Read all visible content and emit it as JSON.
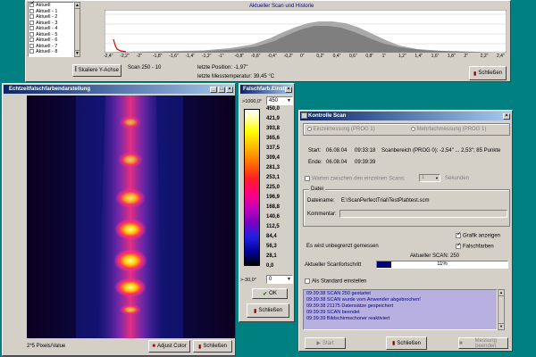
{
  "history_window": {
    "channels": [
      "Aktuell",
      "Aktuell - 1",
      "Aktuell - 2",
      "Aktuell - 3",
      "Aktuell - 4",
      "Aktuell - 5",
      "Aktuell - 6",
      "Aktuell - 7",
      "Aktuell - 8"
    ],
    "chart_title": "Aktueller Scan und Historie",
    "y_ticks": [
      "200 °C",
      "150 °C",
      "100 °C",
      "50 °C"
    ],
    "x_ticks": [
      "-2,4\"",
      "-2,2\"",
      "-2\"",
      "-1,8\"",
      "-1,6\"",
      "-1,4\"",
      "-1,2\"",
      "-1\"",
      "-0,8\"",
      "-0,6\"",
      "-0,4\"",
      "-0,2\"",
      "0\"",
      "0,2\"",
      "0,4\"",
      "0,6\"",
      "0,8\"",
      "1\"",
      "1,2\"",
      "1,4\"",
      "1,6\"",
      "1,8\"",
      "2\"",
      "2,2\"",
      "2,4\""
    ],
    "scale_button": "Skaliere Y-Achse",
    "scan_label": "Scan 250 - 10",
    "last_position": "letzte Position: -1,97\"",
    "last_temperature": "letzte Messtemperatur: 39,45 °C",
    "close_button": "Schließen"
  },
  "falsecolor_window": {
    "title": "Echtzeitfalschfarbendarstellung",
    "status": "2*5 Pixels/Value",
    "adjust_button": "Adjust Color",
    "close_button": "Schließen"
  },
  "scale_window": {
    "title": "Falschfarb.Einst.",
    "max_label": ">1000,0°",
    "max_value": "450",
    "labels": [
      "450,0",
      "421,9",
      "393,8",
      "365,6",
      "337,5",
      "309,4",
      "281,3",
      "253,1",
      "225,0",
      "196,9",
      "168,8",
      "140,6",
      "112,5",
      "84,4",
      "56,3",
      "28,1",
      "0,0"
    ],
    "min_label": ">-30,0°",
    "min_value": "0",
    "ok_button": "OK",
    "close_button": "Schließen"
  },
  "control_window": {
    "title": "Kontrolle Scan",
    "single_measure": "Einzelmessung (PROG 1)",
    "multi_measure": "Mehrfachmessung (PROG 1)",
    "start_label": "Start:",
    "start_date": "06.08.04",
    "start_time": "09:33:18",
    "end_label": "Ende:",
    "end_date": "06.08.04",
    "end_time": "09:39:39",
    "scan_range": "Scanbereich (PROG 0): -2,54\" ... 2,53\"; 85 Punkte",
    "wait_label": "Warten zwischen den einzelnen Scans:",
    "wait_value": "1",
    "wait_unit": "Sekunden",
    "file_group": "Datei",
    "filename_label": "Dateiname:",
    "filename_value": "E:\\ScanPerfectTrial\\TestPlat\\test.scm",
    "comment_label": "Kommentar:",
    "show_graph": "Grafik anzeigen",
    "false_colors": "Falschfarben",
    "status": "Es wird unbegrenzt gemessen",
    "current_scan": "Aktueller SCAN: 250",
    "progress_label": "Aktueller Scanfortschritt",
    "progress_text": "11%",
    "progress_value": 0.11,
    "default_checkbox": "Als Standard einstellen",
    "log": [
      "09:39:38 SCAN 250 gestartet",
      "09:39:38 SCAN wurde vom Anwender abgebrochen!",
      "09:39:38 21175 Datensätze gespeichert",
      "09:39:39 SCAN beendet",
      "09:39:39 Bildschirmschoner reaktiviert"
    ],
    "start_button": "Start",
    "close_button": "Schließen",
    "measure_button": "Messung beenden"
  }
}
